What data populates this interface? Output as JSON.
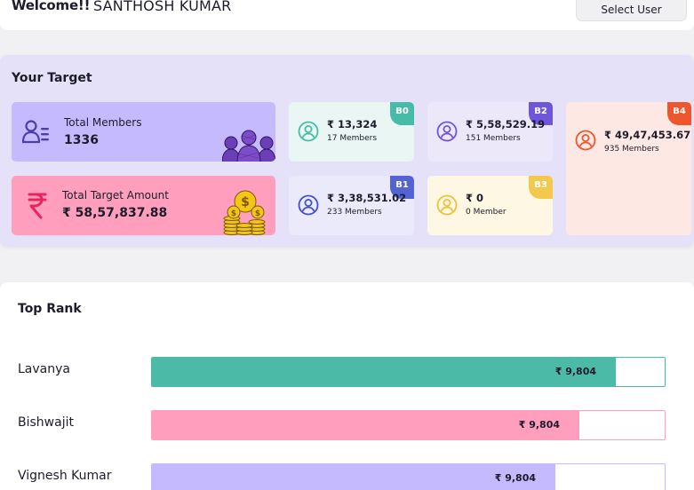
{
  "header": {
    "welcome": "Welcome!!",
    "username": "SANTHOSH KUMAR",
    "select_user_label": "Select User"
  },
  "target": {
    "title": "Your Target",
    "total_members_label": "Total Members",
    "total_members_value": "1336",
    "total_amount_label": "Total Target Amount",
    "total_amount_value": "₹ 58,57,837.88",
    "branches": [
      {
        "badge": "B0",
        "amount": "₹ 13,324",
        "members": "17 Members",
        "accent": "#46bca8",
        "bg": "#e9f6f3"
      },
      {
        "badge": "B1",
        "amount": "₹ 3,38,531.02",
        "members": "233 Members",
        "accent": "#5363d6",
        "bg": "#eaeafb"
      },
      {
        "badge": "B2",
        "amount": "₹ 5,58,529.19",
        "members": "151 Members",
        "accent": "#6f55d9",
        "bg": "#ece8fa"
      },
      {
        "badge": "B3",
        "amount": "₹ 0",
        "members": "0 Member",
        "accent": "#f2c94c",
        "bg": "#fdf7e4"
      },
      {
        "badge": "B4",
        "amount": "₹ 49,47,453.67",
        "members": "935 Members",
        "accent": "#f0562d",
        "bg": "#fde8e4"
      }
    ]
  },
  "ranking": {
    "title": "Top Rank",
    "rows": [
      {
        "name": "Lavanya",
        "amount": "₹ 9,804",
        "progress": 0.901,
        "color": "#4bbaa7"
      },
      {
        "name": "Bishwajit",
        "amount": "₹ 9,804",
        "progress": 0.831,
        "color": "#ff9fbd"
      },
      {
        "name": "Vignesh Kumar",
        "amount": "₹ 9,804",
        "progress": 0.784,
        "color": "#c5bafd"
      }
    ]
  }
}
